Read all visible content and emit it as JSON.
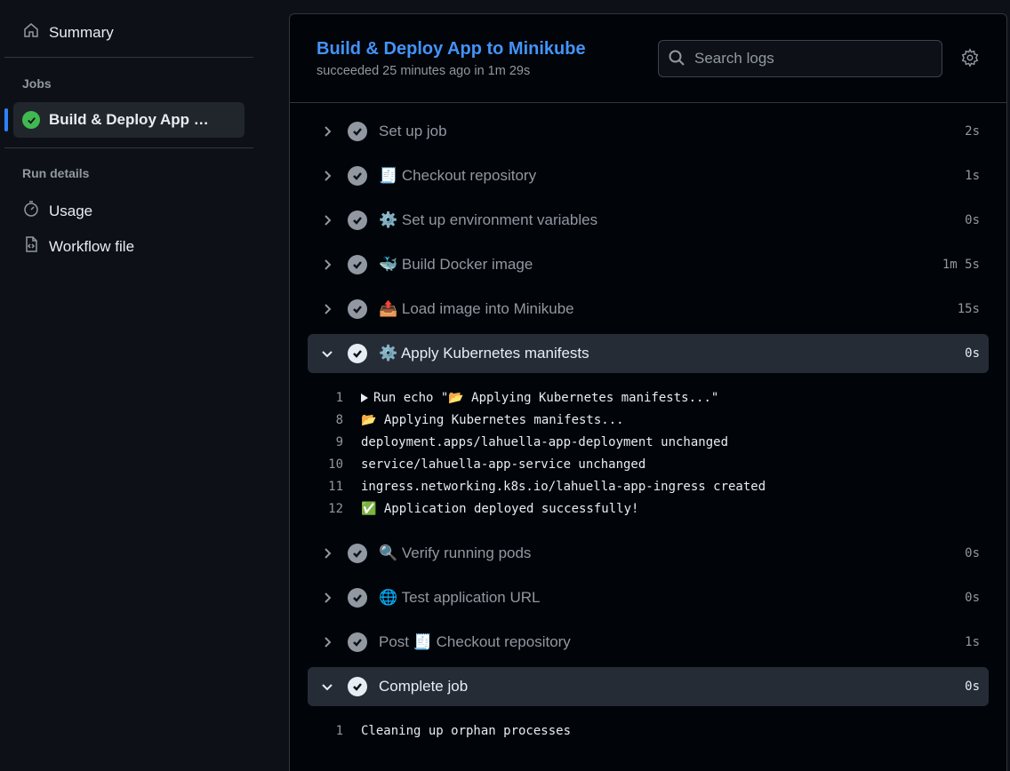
{
  "sidebar": {
    "summary_label": "Summary",
    "jobs_heading": "Jobs",
    "job_label": "Build & Deploy App to Minikube",
    "run_details_heading": "Run details",
    "usage_label": "Usage",
    "workflow_file_label": "Workflow file"
  },
  "header": {
    "title": "Build & Deploy App to Minikube",
    "subtitle": "succeeded 25 minutes ago in 1m 29s",
    "search_placeholder": "Search logs"
  },
  "steps": [
    {
      "name": "Set up job",
      "duration": "2s",
      "expanded": false
    },
    {
      "name": "🧾 Checkout repository",
      "duration": "1s",
      "expanded": false
    },
    {
      "name": "⚙️ Set up environment variables",
      "duration": "0s",
      "expanded": false
    },
    {
      "name": "🐳 Build Docker image",
      "duration": "1m 5s",
      "expanded": false
    },
    {
      "name": "📤 Load image into Minikube",
      "duration": "15s",
      "expanded": false
    },
    {
      "name": "⚙️ Apply Kubernetes manifests",
      "duration": "0s",
      "expanded": true
    },
    {
      "name": "🔍 Verify running pods",
      "duration": "0s",
      "expanded": false
    },
    {
      "name": "🌐 Test application URL",
      "duration": "0s",
      "expanded": false
    },
    {
      "name": "Post 🧾 Checkout repository",
      "duration": "1s",
      "expanded": false
    },
    {
      "name": "Complete job",
      "duration": "0s",
      "expanded": true
    }
  ],
  "apply_logs": [
    {
      "num": "1",
      "text": "Run echo \"📂 Applying Kubernetes manifests...\"",
      "collapsible": true
    },
    {
      "num": "8",
      "text": "📂 Applying Kubernetes manifests...",
      "collapsible": false
    },
    {
      "num": "9",
      "text": "deployment.apps/lahuella-app-deployment unchanged",
      "collapsible": false
    },
    {
      "num": "10",
      "text": "service/lahuella-app-service unchanged",
      "collapsible": false
    },
    {
      "num": "11",
      "text": "ingress.networking.k8s.io/lahuella-app-ingress created",
      "collapsible": false
    },
    {
      "num": "12",
      "text": "✅ Application deployed successfully!",
      "collapsible": false
    }
  ],
  "complete_logs": [
    {
      "num": "1",
      "text": "Cleaning up orphan processes",
      "collapsible": false
    }
  ],
  "colors": {
    "accent": "#2f81f7",
    "success": "#3fb950",
    "link": "#4493f8"
  }
}
